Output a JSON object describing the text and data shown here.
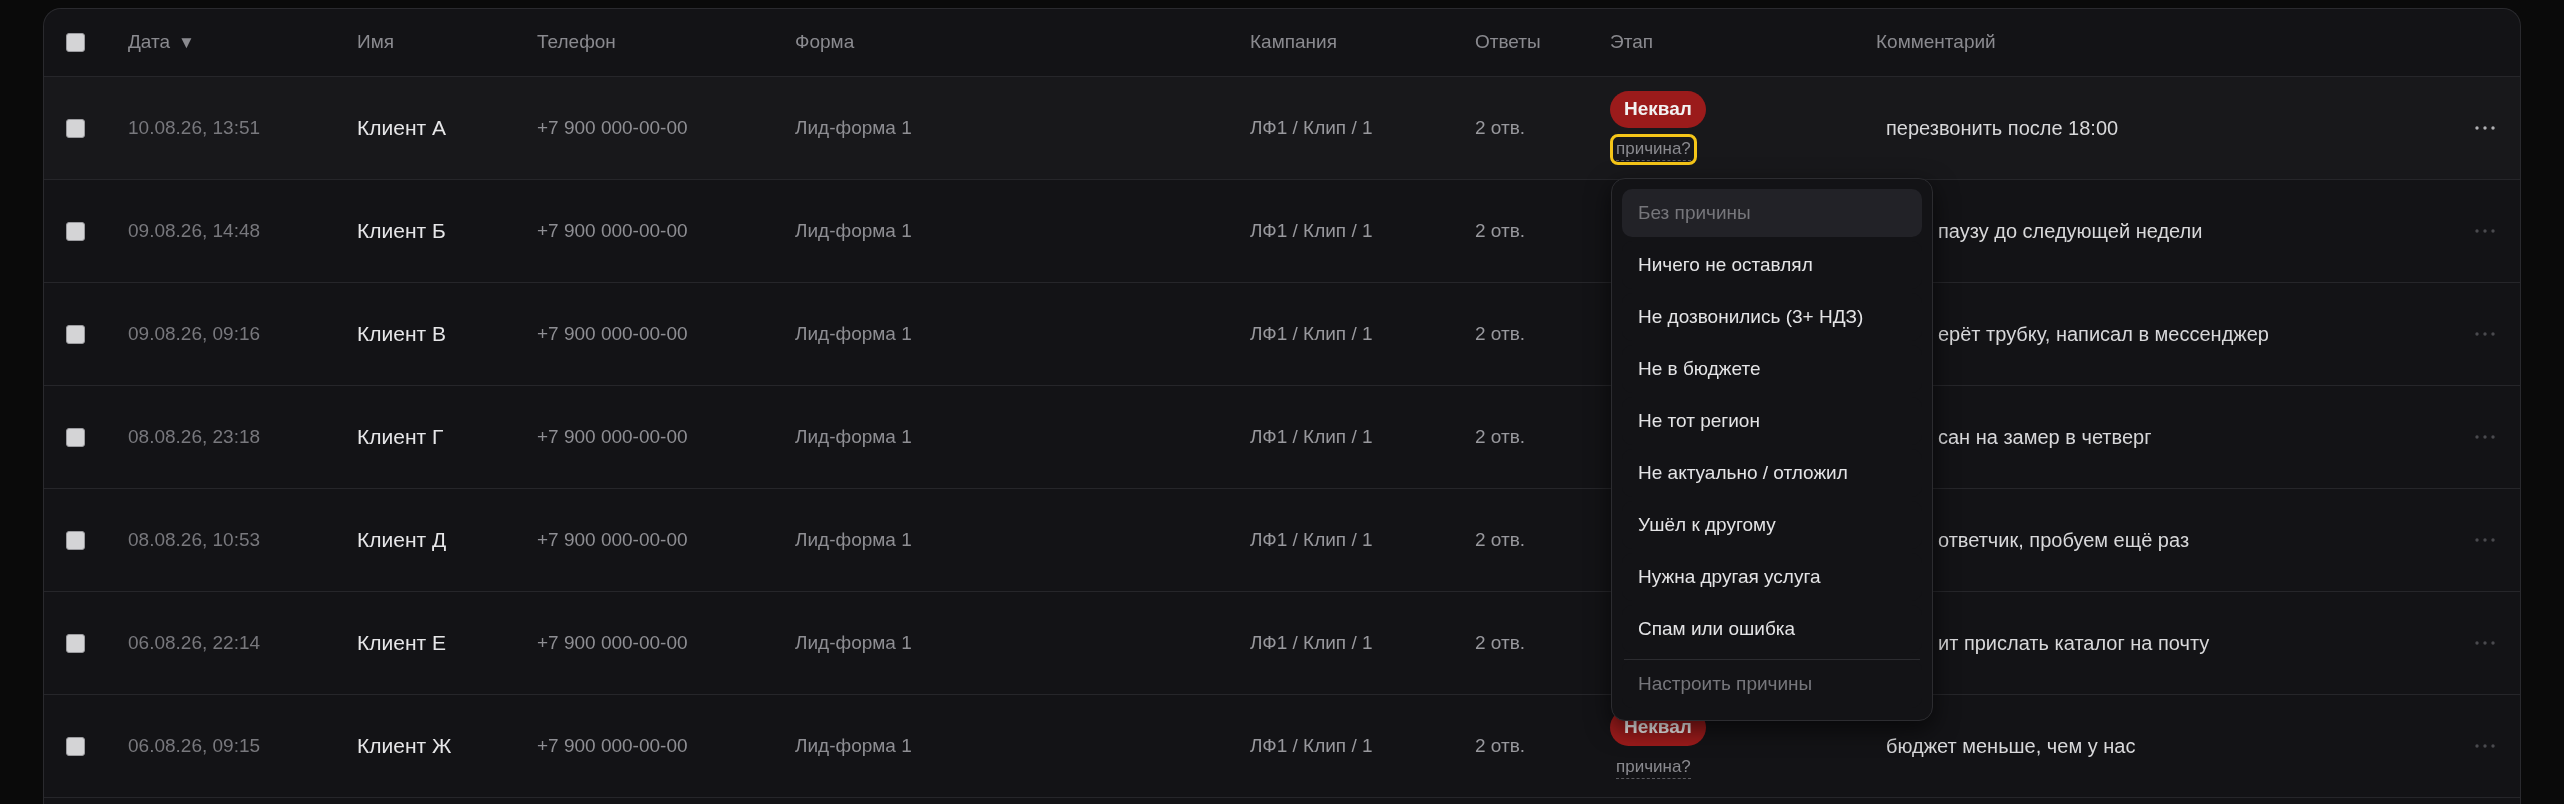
{
  "table": {
    "select_all": {
      "checked": false
    },
    "columns": [
      {
        "label": "Дата",
        "sort": "▼"
      },
      {
        "label": "Имя"
      },
      {
        "label": "Телефон"
      },
      {
        "label": "Форма"
      },
      {
        "label": "Кампания"
      },
      {
        "label": "Ответы"
      },
      {
        "label": "Этап"
      },
      {
        "label": "Комментарий"
      }
    ],
    "rows": [
      {
        "checked": false,
        "hovered": true,
        "date": "10.08.26, 13:51",
        "name": "Клиент А",
        "phone": "+7 900 000-00-00",
        "form": "Лид-форма 1",
        "campaign": "ЛФ1 / Клип / 1",
        "answers": "2 отв.",
        "stage": {
          "label": "Неквал",
          "reason": "причина?",
          "focused": true
        },
        "comment": "перезвонить после 18:00"
      },
      {
        "checked": false,
        "hovered": false,
        "date": "09.08.26, 14:48",
        "name": "Клиент Б",
        "phone": "+7 900 000-00-00",
        "form": "Лид-форма 1",
        "campaign": "ЛФ1 / Клип / 1",
        "answers": "2 отв.",
        "comment": "паузу до следующей недели"
      },
      {
        "checked": false,
        "hovered": false,
        "date": "09.08.26, 09:16",
        "name": "Клиент В",
        "phone": "+7 900 000-00-00",
        "form": "Лид-форма 1",
        "campaign": "ЛФ1 / Клип / 1",
        "answers": "2 отв.",
        "comment": "ерёт трубку, написал в мессенджер"
      },
      {
        "checked": false,
        "hovered": false,
        "date": "08.08.26, 23:18",
        "name": "Клиент Г",
        "phone": "+7 900 000-00-00",
        "form": "Лид-форма 1",
        "campaign": "ЛФ1 / Клип / 1",
        "answers": "2 отв.",
        "comment": "сан на замер в четверг"
      },
      {
        "checked": false,
        "hovered": false,
        "date": "08.08.26, 10:53",
        "name": "Клиент Д",
        "phone": "+7 900 000-00-00",
        "form": "Лид-форма 1",
        "campaign": "ЛФ1 / Клип / 1",
        "answers": "2 отв.",
        "comment": "ответчик, пробуем ещё раз"
      },
      {
        "checked": false,
        "hovered": false,
        "date": "06.08.26, 22:14",
        "name": "Клиент Е",
        "phone": "+7 900 000-00-00",
        "form": "Лид-форма 1",
        "campaign": "ЛФ1 / Клип / 1",
        "answers": "2 отв.",
        "comment": "ит прислать каталог на почту"
      },
      {
        "checked": false,
        "hovered": false,
        "date": "06.08.26, 09:15",
        "name": "Клиент Ж",
        "phone": "+7 900 000-00-00",
        "form": "Лид-форма 1",
        "campaign": "ЛФ1 / Клип / 1",
        "answers": "2 отв.",
        "stage": {
          "label": "Неквал",
          "reason": "причина?",
          "focused": false
        },
        "comment": "бюджет меньше, чем у нас"
      }
    ]
  },
  "reason_menu": {
    "items": [
      {
        "label": "Без причины",
        "kind": "none",
        "selected": true
      },
      {
        "label": "Ничего не оставлял",
        "kind": "option",
        "selected": false
      },
      {
        "label": "Не дозвонились (3+ НДЗ)",
        "kind": "option",
        "selected": false
      },
      {
        "label": "Не в бюджете",
        "kind": "option",
        "selected": false
      },
      {
        "label": "Не тот регион",
        "kind": "option",
        "selected": false
      },
      {
        "label": "Не актуально / отложил",
        "kind": "option",
        "selected": false
      },
      {
        "label": "Ушёл к другому",
        "kind": "option",
        "selected": false
      },
      {
        "label": "Нужна другая услуга",
        "kind": "option",
        "selected": false
      },
      {
        "label": "Спам или ошибка",
        "kind": "option",
        "selected": false
      },
      {
        "label": "Настроить причины",
        "kind": "action",
        "selected": false
      }
    ]
  }
}
